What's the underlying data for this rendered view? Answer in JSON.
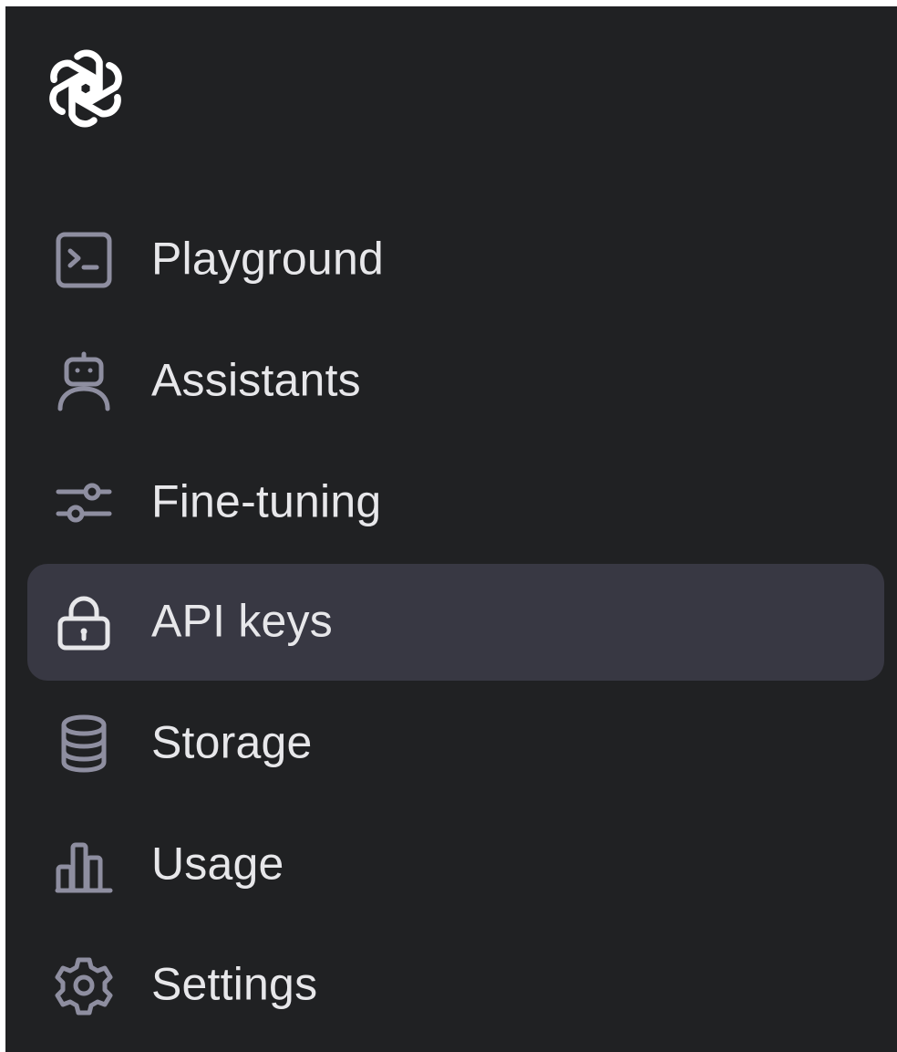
{
  "app": {
    "logo_icon": "openai-logo"
  },
  "colors": {
    "sidebar_bg": "#202123",
    "active_item_bg": "#383843",
    "label_text": "#e7e7ea",
    "icon_muted": "#8e8ea0",
    "icon_active": "#e7e7ea"
  },
  "sidebar": {
    "items": [
      {
        "label": "Playground",
        "icon": "terminal-icon",
        "active": false
      },
      {
        "label": "Assistants",
        "icon": "robot-icon",
        "active": false
      },
      {
        "label": "Fine-tuning",
        "icon": "sliders-icon",
        "active": false
      },
      {
        "label": "API keys",
        "icon": "lock-icon",
        "active": true
      },
      {
        "label": "Storage",
        "icon": "database-icon",
        "active": false
      },
      {
        "label": "Usage",
        "icon": "bar-chart-icon",
        "active": false
      },
      {
        "label": "Settings",
        "icon": "gear-icon",
        "active": false
      }
    ]
  }
}
